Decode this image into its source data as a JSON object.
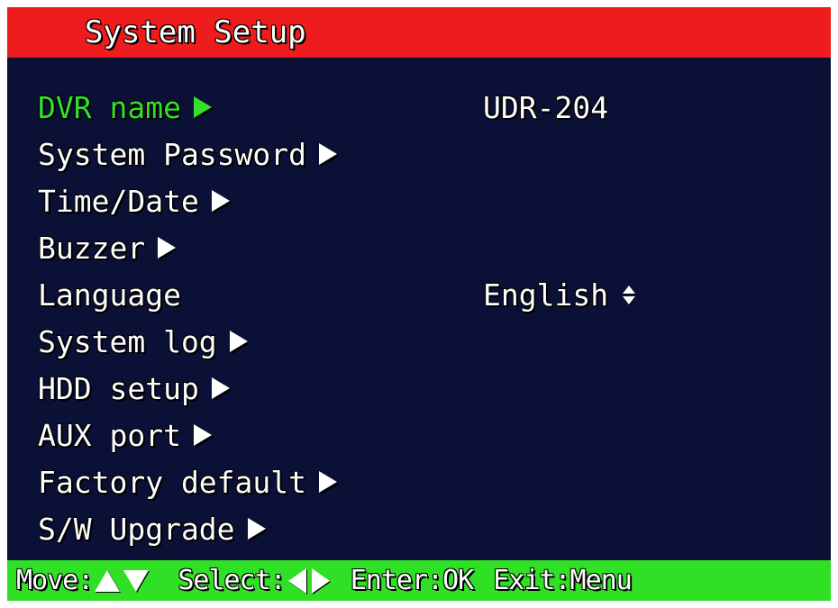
{
  "title": "System Setup",
  "menu": {
    "items": [
      {
        "label": "DVR name",
        "selected": true,
        "has_arrow": true,
        "value": "UDR-204"
      },
      {
        "label": "System Password",
        "has_arrow": true
      },
      {
        "label": "Time/Date",
        "has_arrow": true
      },
      {
        "label": "Buzzer",
        "has_arrow": true
      },
      {
        "label": "Language",
        "has_arrow": false,
        "value": "English"
      },
      {
        "label": "System log",
        "has_arrow": true
      },
      {
        "label": "HDD setup",
        "has_arrow": true
      },
      {
        "label": "AUX port",
        "has_arrow": true
      },
      {
        "label": "Factory default",
        "has_arrow": true
      },
      {
        "label": "S/W Upgrade",
        "has_arrow": true
      }
    ]
  },
  "footer": {
    "move_label": "Move:",
    "select_label": "Select:",
    "enter_hint": "Enter:OK",
    "exit_hint": "Exit:Menu"
  },
  "colors": {
    "title_bar": "#ee1c1c",
    "background": "#0b1036",
    "selected_text": "#35e02b",
    "footer_bar": "#2fe025",
    "text": "#ffffff"
  },
  "icons": {
    "submenu_arrow": "right-triangle-icon",
    "language_spinner": "up-down-icon",
    "move_keys": [
      "up-triangle-icon",
      "down-triangle-icon"
    ],
    "select_keys": [
      "left-triangle-icon",
      "right-triangle-icon"
    ]
  }
}
